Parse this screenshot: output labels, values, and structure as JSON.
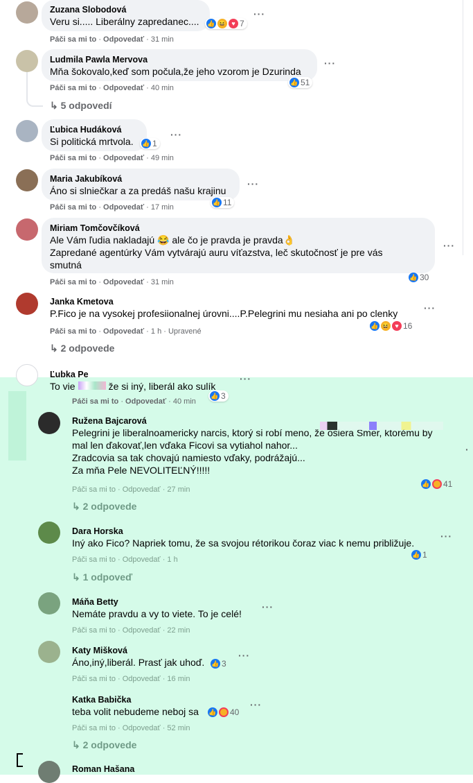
{
  "comments": [
    {
      "author": "Zuzana Slobodová",
      "text": "Veru si..... Liberálny zapredanec....",
      "like": "Páči sa mi to",
      "reply": "Odpovedať",
      "time": "31 min",
      "reactions": "7"
    },
    {
      "author": "Ludmila Pawla Mervova",
      "text": "Mňa šokovalo,keď som počula,že jeho vzorom je Dzurinda",
      "like": "Páči sa mi to",
      "reply": "Odpovedať",
      "time": "40 min",
      "reactions": "51",
      "replies": "5 odpovedí"
    },
    {
      "author": "Ľubica Hudáková",
      "text": "Si politická mrtvola.",
      "like": "Páči sa mi to",
      "reply": "Odpovedať",
      "time": "49 min",
      "reactions": "1"
    },
    {
      "author": "Maria Jakubíková",
      "text": "Áno si slniečkar a za predáš našu krajinu",
      "like": "Páči sa mi to",
      "reply": "Odpovedať",
      "time": "17 min",
      "reactions": "11"
    },
    {
      "author": "Miriam Tomčovčíková",
      "text_lines": [
        "Ale Vám ľudia nakladajú 😂 ale čo je pravda je pravda👌",
        "Zapredané agentúrky Vám vytvárajú auru víťazstva, leč skutočnosť je pre vás",
        "smutná"
      ],
      "like": "Páči sa mi to",
      "reply": "Odpovedať",
      "time": "31 min",
      "reactions": "30"
    },
    {
      "author": "Janka Kmetova",
      "text": "P.Fico je na vysokej profesiionalnej úrovni....P.Pelegrini mu nesiaha ani po clenky",
      "like": "Páči sa mi to",
      "reply": "Odpovedať",
      "time": "1 h",
      "edited": "Upravené",
      "reactions": "16",
      "replies": "2 odpovede"
    },
    {
      "author": "Ľubka Pe",
      "text_a": "To vie",
      "text_b": "že si iný, liberál ako sulík",
      "like": "Páči sa mi to",
      "reply": "Odpovedať",
      "time": "40 min",
      "reactions": "3"
    },
    {
      "author": "Ružena Bajcarová",
      "text_lines": [
        "Pelegrini je liberalnoamericky narcis, ktorý si robí meno, že osiera Smer, ktorému by",
        "mal len ďakovať,len vďaka Ficovi sa vytiahol nahor...",
        "Zradcovia sa tak chovajú namiesto vďaky, podrážajú...",
        "Za mňa Pele NEVOLITEĽNÝ!!!!!"
      ],
      "like": "Páči sa mi to",
      "reply": "Odpovedať",
      "time": "27 min",
      "reactions": "41",
      "replies": "2 odpovede"
    },
    {
      "author": "Dara Horska",
      "text": "Iný ako Fico? Napriek tomu, že sa svojou rétorikou čoraz viac k nemu približuje.",
      "like": "Páči sa mi to",
      "reply": "Odpovedať",
      "time": "1 h",
      "reactions": "1",
      "replies": "1 odpoveď"
    },
    {
      "author": "Máňa Betty",
      "text": "Nemáte pravdu a vy to viete. To je celé!",
      "like": "Páči sa mi to",
      "reply": "Odpovedať",
      "time": "22 min"
    },
    {
      "author": "Katy Mišková",
      "text": "Áno,iný,liberál. Prasť jak uhoď.",
      "like": "Páči sa mi to",
      "reply": "Odpovedať",
      "time": "16 min",
      "reactions": "3"
    },
    {
      "author": "Katka Babička",
      "text": "teba volit nebudeme neboj sa",
      "like": "Páči sa mi to",
      "reply": "Odpovedať",
      "time": "52 min",
      "reactions": "40",
      "replies": "2 odpovede"
    },
    {
      "author": "Roman Hašana"
    }
  ]
}
